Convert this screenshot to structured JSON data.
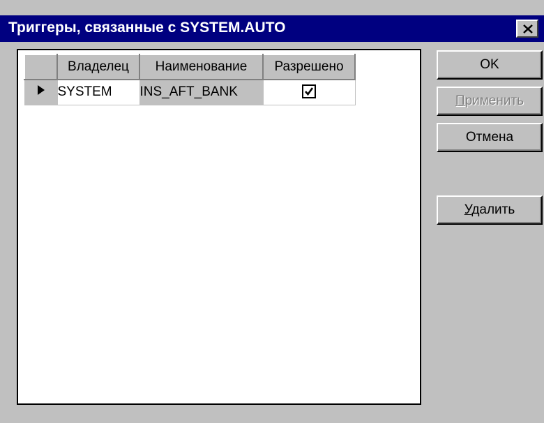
{
  "window": {
    "title": "Триггеры, связанные с SYSTEM.AUTO"
  },
  "grid": {
    "columns": [
      "Владелец",
      "Наименование",
      "Разрешено"
    ],
    "rows": [
      {
        "owner": "SYSTEM",
        "name": "INS_AFT_BANK",
        "enabled": true
      }
    ]
  },
  "buttons": {
    "ok": "OK",
    "apply_first": "П",
    "apply_rest": "рименить",
    "cancel": "Отмена",
    "delete_first": "У",
    "delete_rest": "далить"
  },
  "icons": {
    "close": "close-icon",
    "row_indicator": "row-pointer-icon",
    "check": "checkmark-icon"
  }
}
